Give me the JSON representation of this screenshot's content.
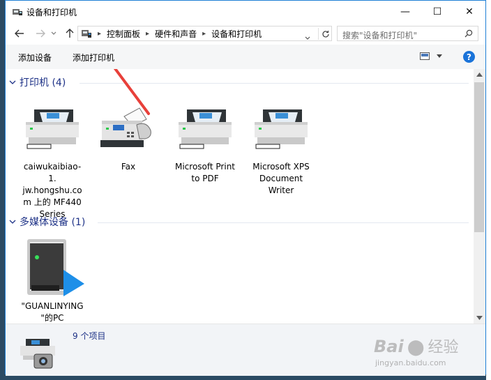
{
  "window": {
    "title": "设备和打印机",
    "minimize_glyph": "—",
    "maximize_glyph": "☐",
    "close_glyph": "✕"
  },
  "address": {
    "crumbs": [
      "控制面板",
      "硬件和声音",
      "设备和打印机"
    ],
    "search_placeholder": "搜索\"设备和打印机\""
  },
  "toolbar": {
    "add_device": "添加设备",
    "add_printer": "添加打印机"
  },
  "groups": {
    "printers": {
      "label": "打印机 (4)",
      "items": [
        {
          "label": "caiwukaibiao-1.\njw.hongshu.co\nm 上的 MF440\nSeries",
          "icon": "printer-icon"
        },
        {
          "label": "Fax",
          "icon": "fax-icon"
        },
        {
          "label": "Microsoft Print\nto PDF",
          "icon": "printer-icon"
        },
        {
          "label": "Microsoft XPS\nDocument\nWriter",
          "icon": "printer-icon"
        }
      ]
    },
    "media": {
      "label": "多媒体设备 (1)",
      "items": [
        {
          "label": "\"GUANLINYING\n\"的PC",
          "icon": "media-pc-icon"
        }
      ]
    }
  },
  "status": {
    "count": "9 个项目"
  },
  "watermark": {
    "brand": "Bai",
    "brand_cn": "经验",
    "url": "jingyan.baidu.com"
  },
  "colors": {
    "accent": "#1e7fd6",
    "group_text": "#1e3287",
    "annotation_arrow": "#e8403a"
  }
}
